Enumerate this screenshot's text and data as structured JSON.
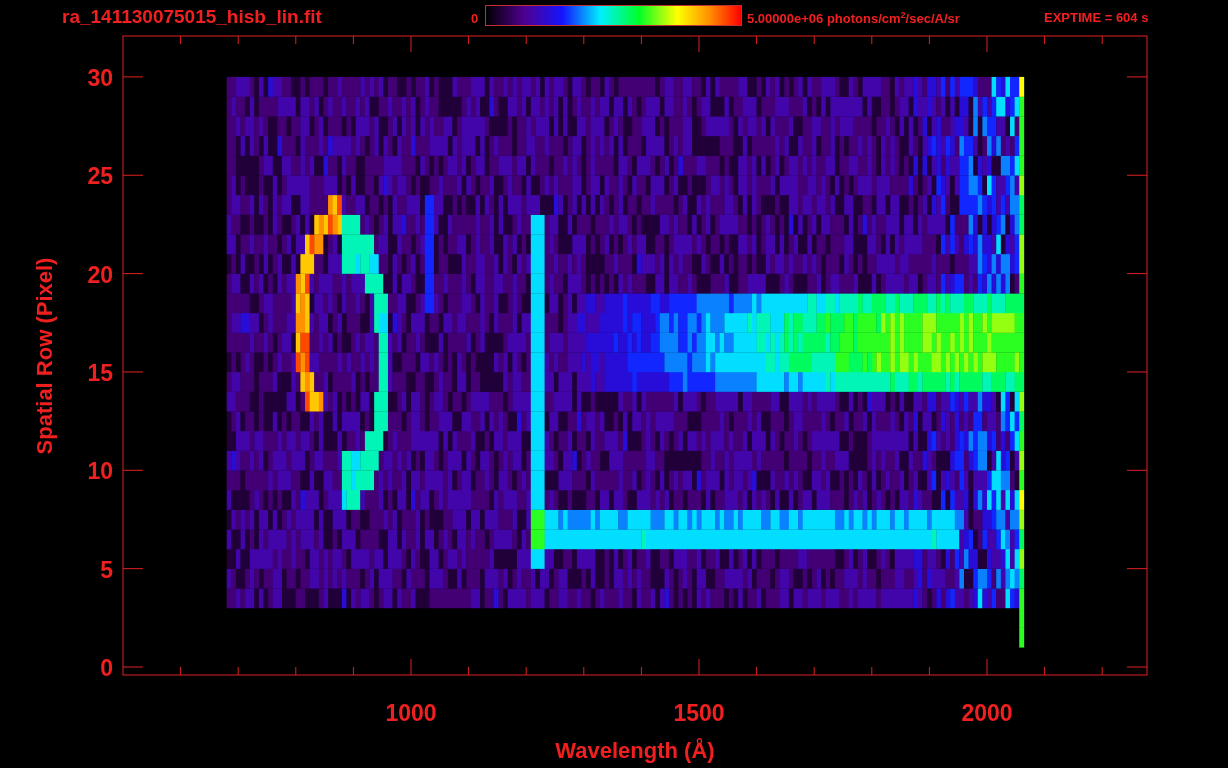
{
  "title": "ra_141130075015_hisb_lin.fit",
  "colorbar": {
    "min_label": "0",
    "max_label": "5.00000e+06 photons/cm$^{2}$/sec/A/sr"
  },
  "exptime": "EXPTIME = 604 s",
  "plot": {
    "xlabel": "Wavelength (Å)",
    "ylabel": "Spatial Row (Pixel)",
    "xticks": [
      "1000",
      "1500",
      "2000"
    ],
    "yticks": [
      "30",
      "25",
      "20",
      "15",
      "10",
      "5",
      "0"
    ]
  }
}
